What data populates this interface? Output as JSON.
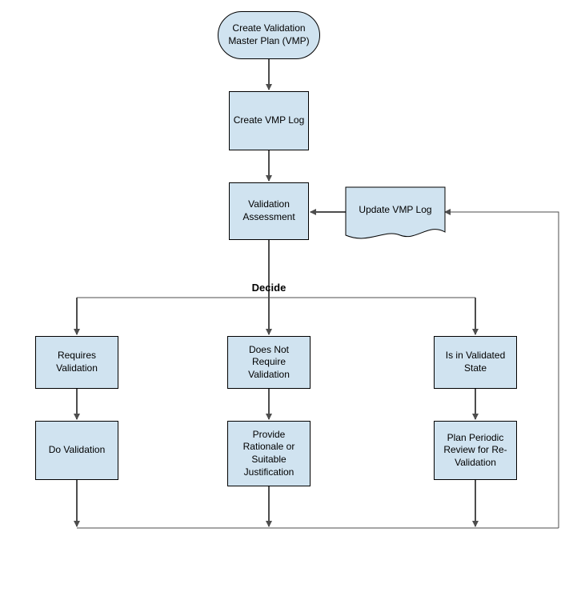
{
  "nodes": {
    "start": "Create Validation\nMaster Plan (VMP)",
    "create_log": "Create VMP Log",
    "validation_assessment": "Validation\nAssessment",
    "update_log": "Update VMP Log",
    "decide_label": "Decide",
    "requires": "Requires\nValidation",
    "not_require": "Does Not\nRequire\nValidation",
    "validated": "Is in Validated\nState",
    "do_validation": "Do Validation",
    "rationale": "Provide\nRationale or\nSuitable\nJustification",
    "periodic": "Plan Periodic\nReview for Re-\nValidation"
  },
  "colors": {
    "node_fill": "#D0E3F0",
    "node_stroke": "#000000",
    "connector": "#4D4D4D"
  },
  "chart_data": {
    "type": "flowchart",
    "title": "",
    "nodes": [
      {
        "id": "start",
        "shape": "terminator",
        "label": "Create Validation Master Plan (VMP)"
      },
      {
        "id": "create_log",
        "shape": "process",
        "label": "Create VMP Log"
      },
      {
        "id": "assessment",
        "shape": "process",
        "label": "Validation Assessment"
      },
      {
        "id": "update_log",
        "shape": "document",
        "label": "Update VMP Log"
      },
      {
        "id": "decide",
        "shape": "label",
        "label": "Decide"
      },
      {
        "id": "requires",
        "shape": "process",
        "label": "Requires Validation"
      },
      {
        "id": "not_require",
        "shape": "process",
        "label": "Does Not Require Validation"
      },
      {
        "id": "validated",
        "shape": "process",
        "label": "Is in Validated State"
      },
      {
        "id": "do_val",
        "shape": "process",
        "label": "Do Validation"
      },
      {
        "id": "rationale",
        "shape": "process",
        "label": "Provide Rationale or Suitable Justification"
      },
      {
        "id": "periodic",
        "shape": "process",
        "label": "Plan Periodic Review for Re-Validation"
      }
    ],
    "edges": [
      {
        "from": "start",
        "to": "create_log"
      },
      {
        "from": "create_log",
        "to": "assessment"
      },
      {
        "from": "assessment",
        "to": "decide"
      },
      {
        "from": "update_log",
        "to": "assessment"
      },
      {
        "from": "decide",
        "to": "requires"
      },
      {
        "from": "decide",
        "to": "not_require"
      },
      {
        "from": "decide",
        "to": "validated"
      },
      {
        "from": "requires",
        "to": "do_val"
      },
      {
        "from": "not_require",
        "to": "rationale"
      },
      {
        "from": "validated",
        "to": "periodic"
      },
      {
        "from": "do_val",
        "to": "update_log",
        "merge": true
      },
      {
        "from": "rationale",
        "to": "update_log",
        "merge": true
      },
      {
        "from": "periodic",
        "to": "update_log",
        "merge": true
      }
    ]
  }
}
